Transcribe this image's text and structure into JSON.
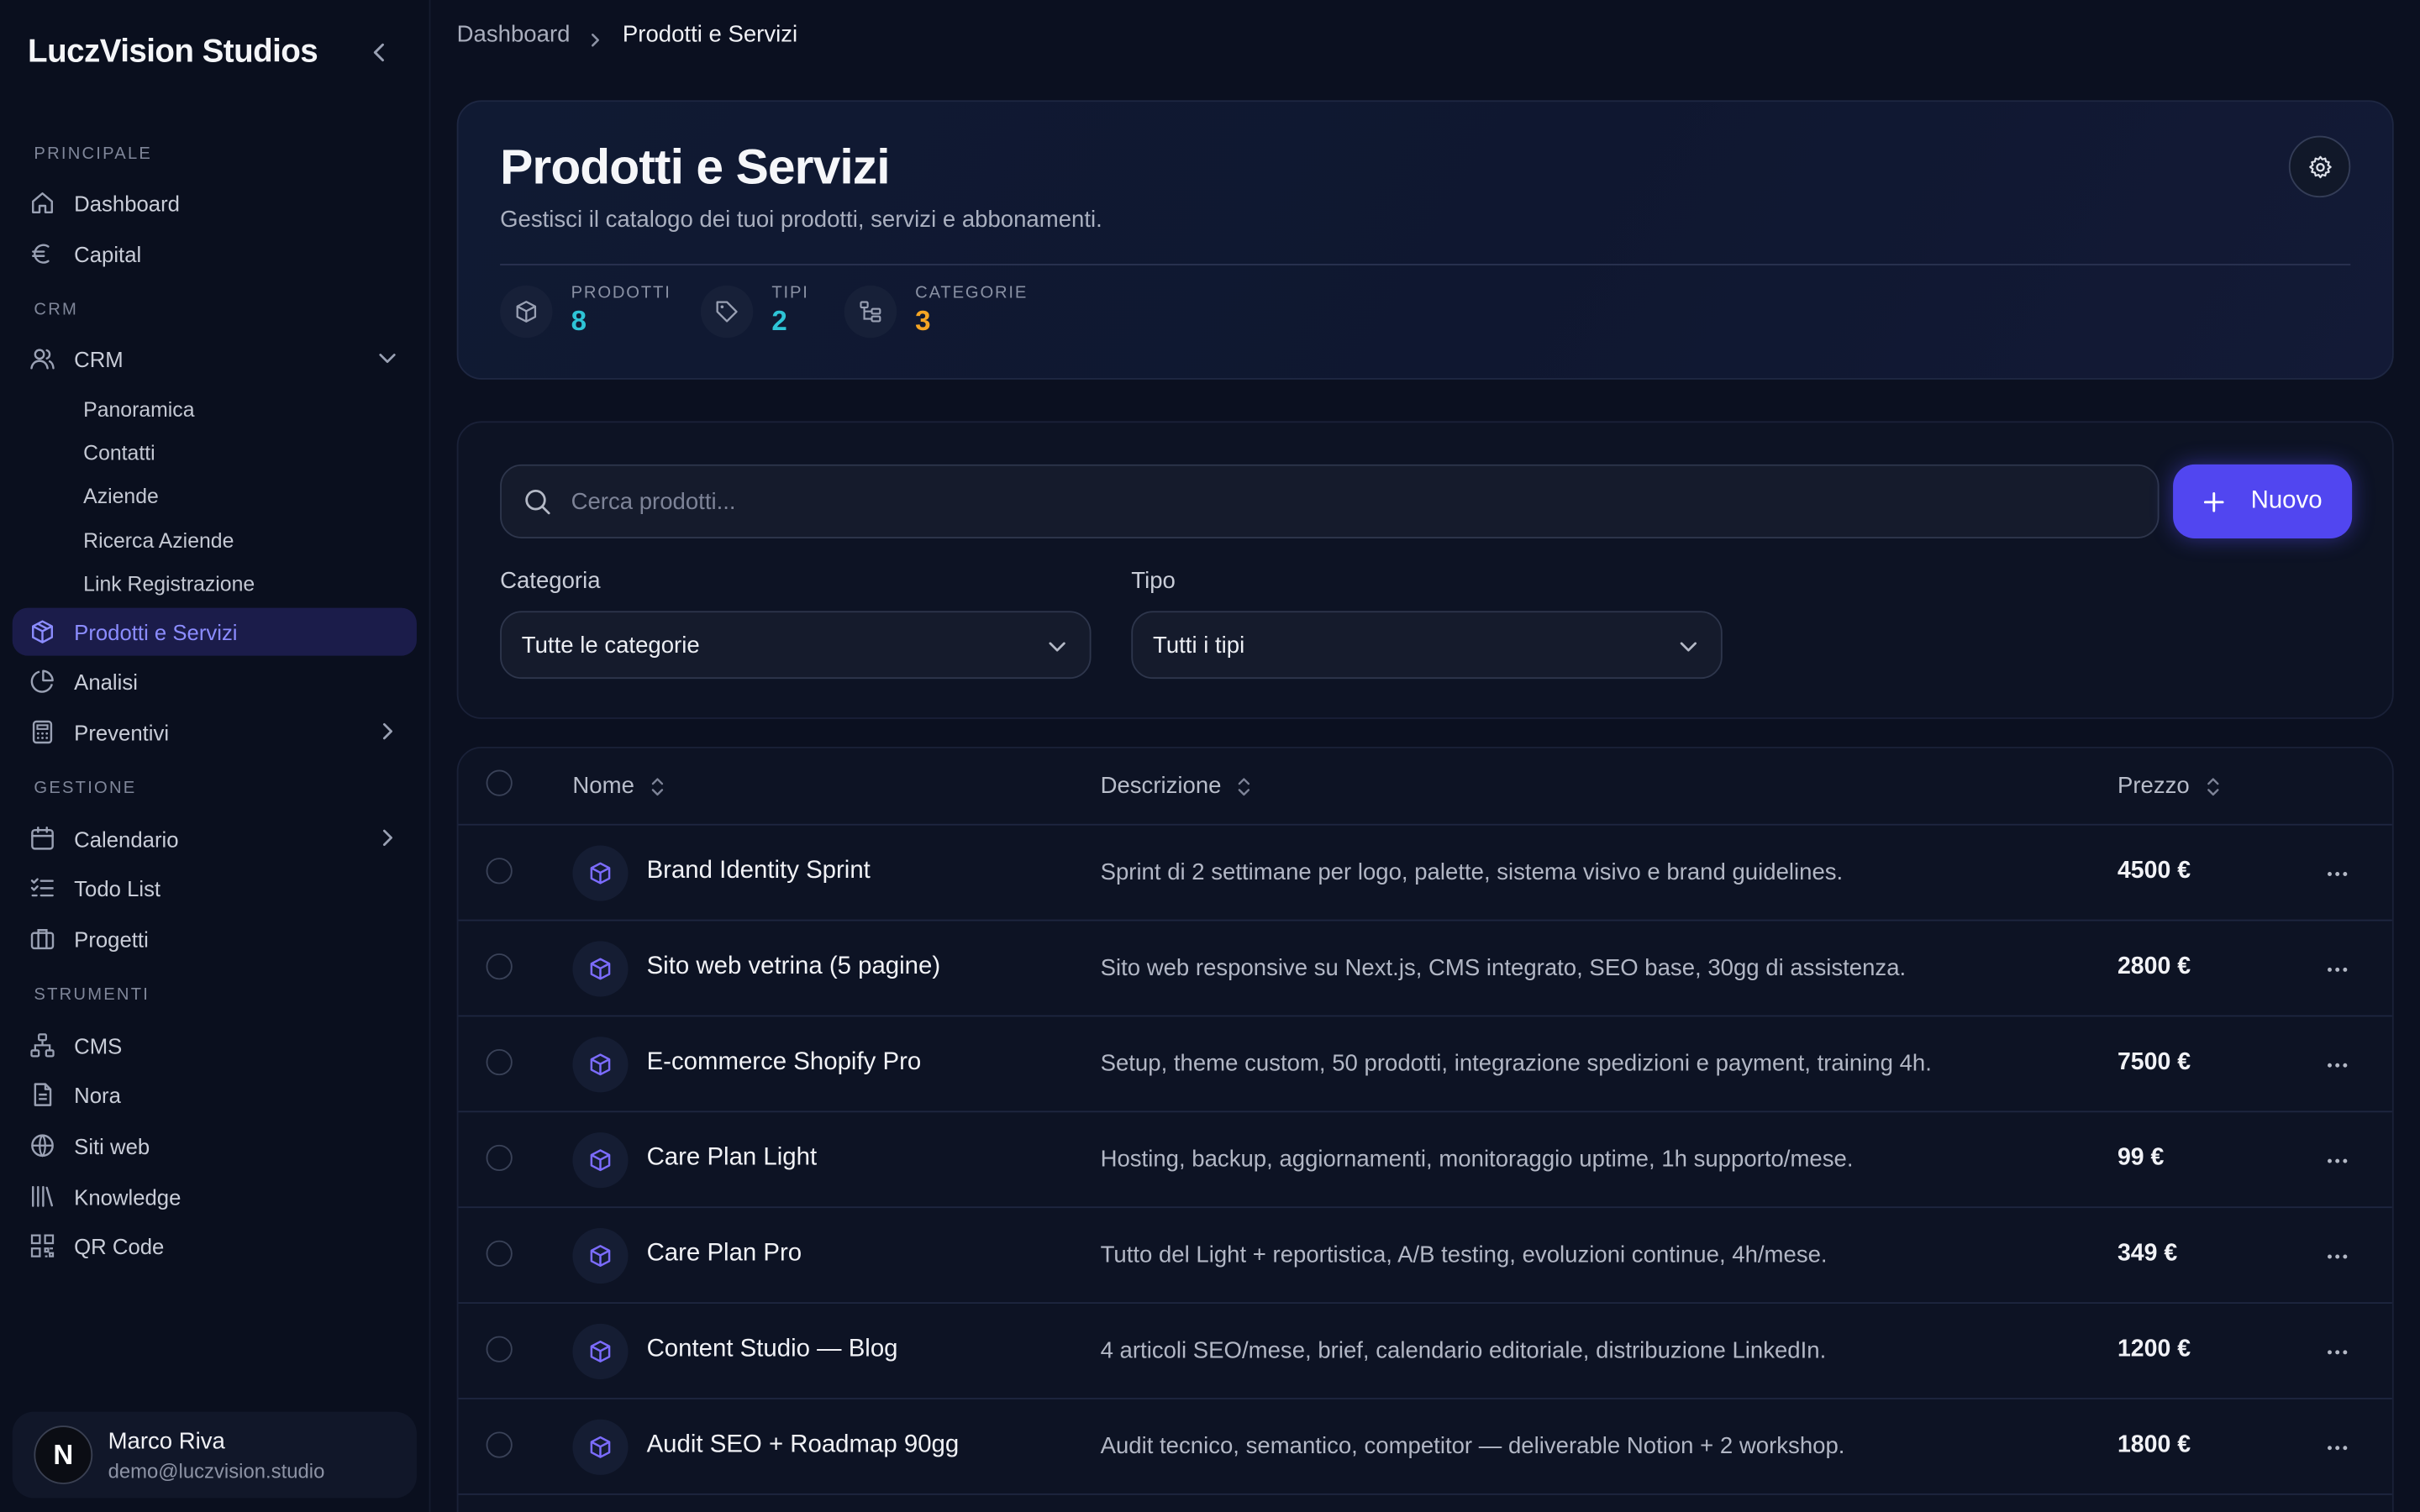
{
  "sidebar": {
    "brand": "LuczVision Studios",
    "sections": {
      "principale": "PRINCIPALE",
      "crm": "CRM",
      "gestione": "GESTIONE",
      "strumenti": "STRUMENTI"
    },
    "items": {
      "dashboard": "Dashboard",
      "capital": "Capital",
      "crm": "CRM",
      "panoramica": "Panoramica",
      "contatti": "Contatti",
      "aziende": "Aziende",
      "ricerca_aziende": "Ricerca Aziende",
      "link_registrazione": "Link Registrazione",
      "prodotti": "Prodotti e Servizi",
      "analisi": "Analisi",
      "preventivi": "Preventivi",
      "calendario": "Calendario",
      "todo": "Todo List",
      "progetti": "Progetti",
      "cms": "CMS",
      "nora": "Nora",
      "siti_web": "Siti web",
      "knowledge": "Knowledge",
      "qr_code": "QR Code"
    },
    "user": {
      "initial": "N",
      "name": "Marco Riva",
      "email": "demo@luczvision.studio"
    }
  },
  "breadcrumb": {
    "root": "Dashboard",
    "current": "Prodotti e Servizi"
  },
  "hero": {
    "title": "Prodotti e Servizi",
    "subtitle": "Gestisci il catalogo dei tuoi prodotti, servizi e abbonamenti.",
    "stats": {
      "prodotti_label": "PRODOTTI",
      "prodotti_value": "8",
      "tipi_label": "TIPI",
      "tipi_value": "2",
      "categorie_label": "CATEGORIE",
      "categorie_value": "3"
    }
  },
  "filters": {
    "search_placeholder": "Cerca prodotti...",
    "new_label": "Nuovo",
    "categoria_label": "Categoria",
    "categoria_value": "Tutte le categorie",
    "tipo_label": "Tipo",
    "tipo_value": "Tutti i tipi"
  },
  "table": {
    "headers": {
      "nome": "Nome",
      "descrizione": "Descrizione",
      "prezzo": "Prezzo"
    },
    "rows": [
      {
        "name": "Brand Identity Sprint",
        "desc": "Sprint di 2 settimane per logo, palette, sistema visivo e brand guidelines.",
        "price": "4500 €"
      },
      {
        "name": "Sito web vetrina (5 pagine)",
        "desc": "Sito web responsive su Next.js, CMS integrato, SEO base, 30gg di assistenza.",
        "price": "2800 €"
      },
      {
        "name": "E-commerce Shopify Pro",
        "desc": "Setup, theme custom, 50 prodotti, integrazione spedizioni e payment, training 4h.",
        "price": "7500 €"
      },
      {
        "name": "Care Plan Light",
        "desc": "Hosting, backup, aggiornamenti, monitoraggio uptime, 1h supporto/mese.",
        "price": "99 €"
      },
      {
        "name": "Care Plan Pro",
        "desc": "Tutto del Light + reportistica, A/B testing, evoluzioni continue, 4h/mese.",
        "price": "349 €"
      },
      {
        "name": "Content Studio — Blog",
        "desc": "4 articoli SEO/mese, brief, calendario editoriale, distribuzione LinkedIn.",
        "price": "1200 €"
      },
      {
        "name": "Audit SEO + Roadmap 90gg",
        "desc": "Audit tecnico, semantico, competitor — deliverable Notion + 2 workshop.",
        "price": "1800 €"
      }
    ]
  },
  "colors": {
    "accent": "#5146f0",
    "active_nav_bg": "#1b1c4a",
    "stat_prodotti": "#2ec4d6",
    "stat_tipi": "#2ec4d6",
    "stat_categorie": "#f5a524"
  }
}
